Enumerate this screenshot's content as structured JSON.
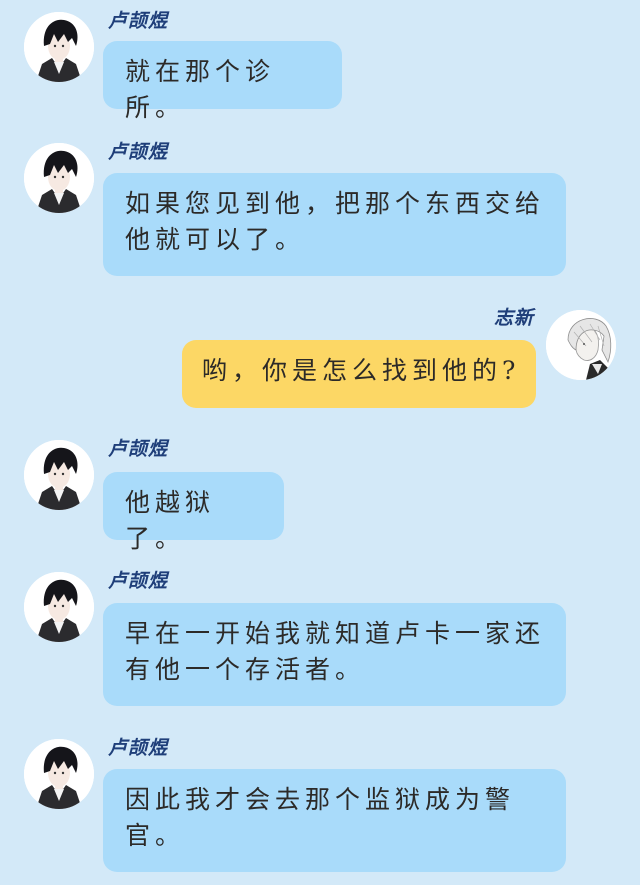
{
  "colors": {
    "background": "#d3e9f8",
    "incoming_bubble": "#a9dbfa",
    "outgoing_bubble": "#fcd765",
    "name_text": "#1f3f7a",
    "message_text": "#2c2a28"
  },
  "messages": [
    {
      "side": "left",
      "sender": "卢颉煜",
      "avatar_icon": "dark-haired-man-avatar-icon",
      "text": "就在那个诊所。"
    },
    {
      "side": "left",
      "sender": "卢颉煜",
      "avatar_icon": "dark-haired-man-avatar-icon",
      "text": "如果您见到他，把那个东西交给他就可以了。"
    },
    {
      "side": "right",
      "sender": "志新",
      "avatar_icon": "white-haired-man-avatar-icon",
      "text": "哟，你是怎么找到他的?"
    },
    {
      "side": "left",
      "sender": "卢颉煜",
      "avatar_icon": "dark-haired-man-avatar-icon",
      "text": "他越狱了。"
    },
    {
      "side": "left",
      "sender": "卢颉煜",
      "avatar_icon": "dark-haired-man-avatar-icon",
      "text": "早在一开始我就知道卢卡一家还有他一个存活者。"
    },
    {
      "side": "left",
      "sender": "卢颉煜",
      "avatar_icon": "dark-haired-man-avatar-icon",
      "text": "因此我才会去那个监狱成为警官。"
    }
  ]
}
